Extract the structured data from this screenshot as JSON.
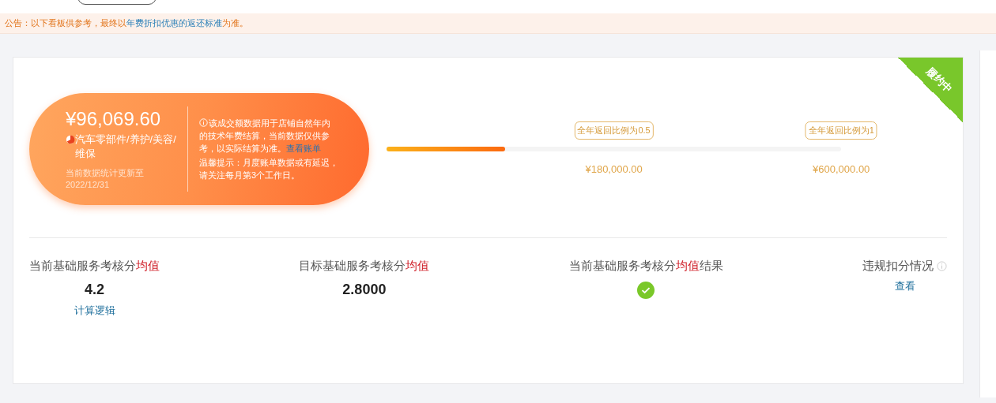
{
  "notice": {
    "prefix": "公告：以下看板供参考，最终以",
    "link": "年费折扣优惠的返还标准",
    "suffix": "为准。"
  },
  "status_ribbon": "履约中",
  "summary": {
    "amount": "¥96,069.60",
    "category": "汽车零部件/养护/美容/维保",
    "updated": "当前数据统计更新至2022/12/31",
    "info": "该成交额数据用于店铺自然年内的技术年费结算，当前数据仅供参考，以实际结算为准。",
    "info_link": "查看账单",
    "tip": "温馨提示：月度账单数据或有延迟，请关注每月第3个工作日。"
  },
  "progress": {
    "level": 0.26,
    "milestones": [
      {
        "tooltip": "全年返回比例为0.5",
        "amount": "¥180,000.00"
      },
      {
        "tooltip": "全年返回比例为1",
        "amount": "¥600,000.00"
      }
    ]
  },
  "metrics": [
    {
      "kind": "value",
      "label": "当前基础服务考核分",
      "highlight": "均值",
      "value": "4.2",
      "link": "计算逻辑"
    },
    {
      "kind": "value",
      "label": "目标基础服务考核分",
      "highlight": "均值",
      "value": "2.8000"
    },
    {
      "kind": "check",
      "label": "当前基础服务考核分",
      "highlight": "均值",
      "suffix": "结果",
      "passed": true
    },
    {
      "kind": "link",
      "label": "违规扣分情况",
      "info": true,
      "link": "查看"
    }
  ]
}
